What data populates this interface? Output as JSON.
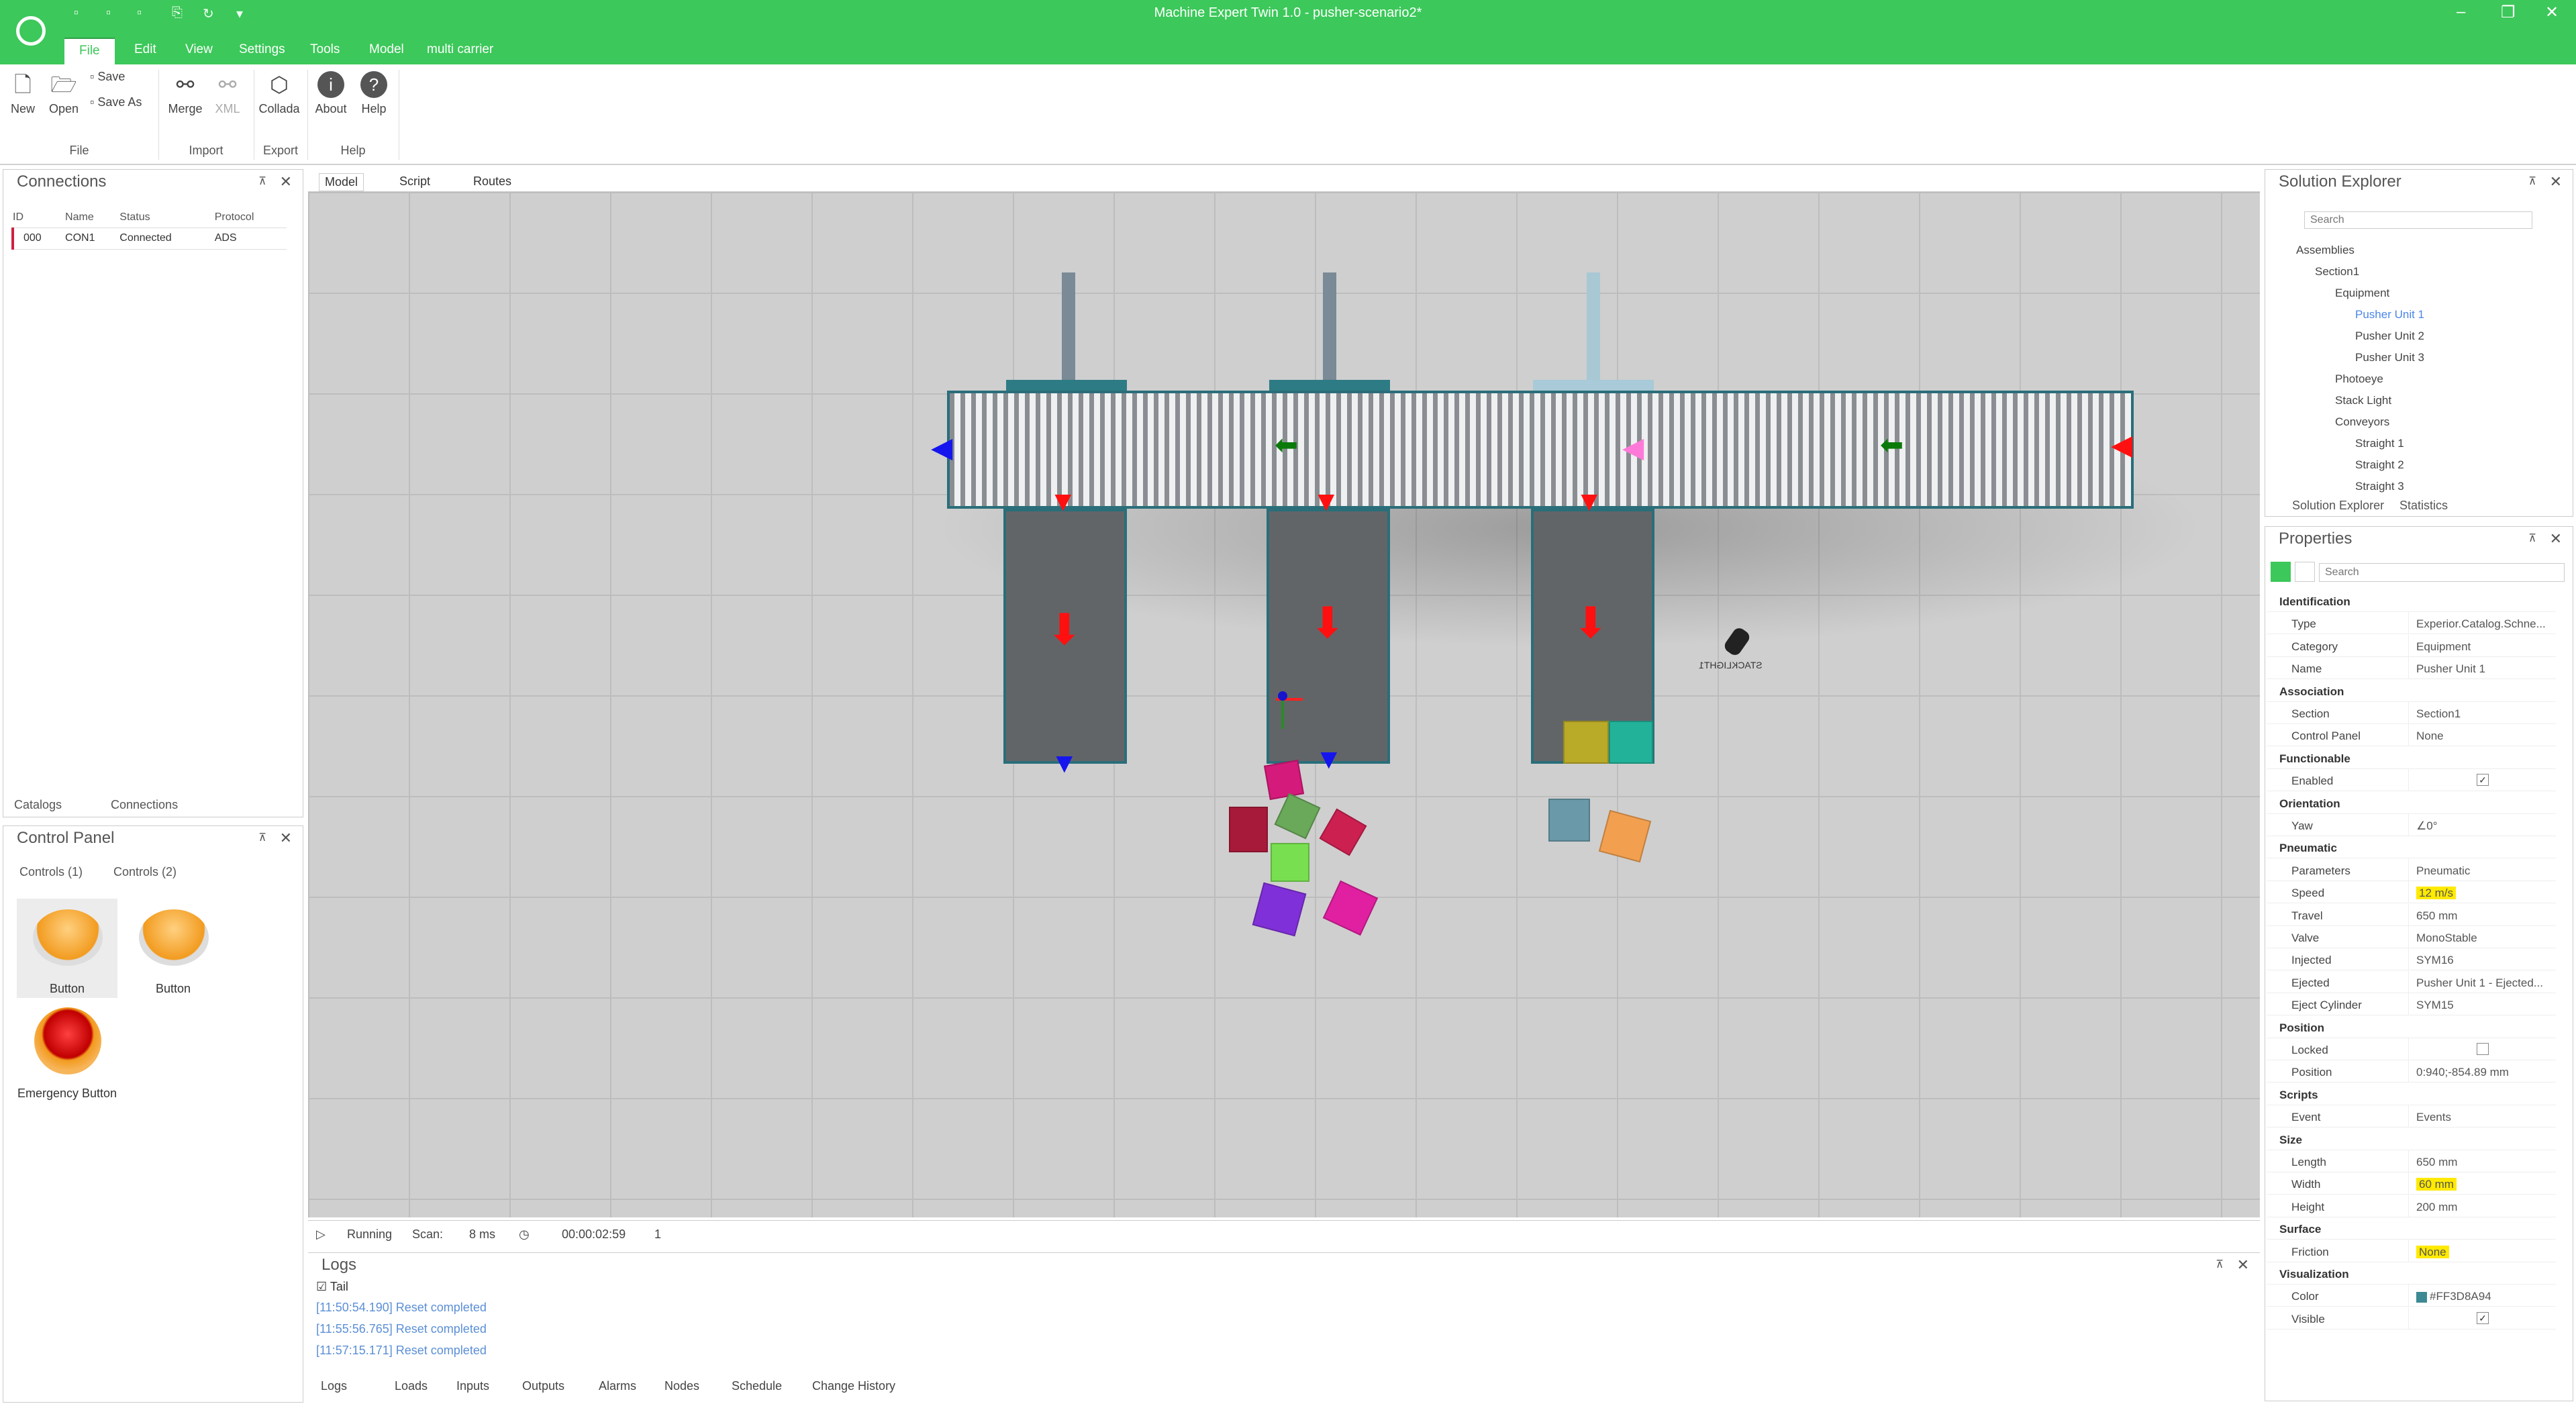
{
  "window": {
    "title": "Machine Expert Twin 1.0 - pusher-scenario2*"
  },
  "menu": [
    "File",
    "Edit",
    "View",
    "Settings",
    "Tools",
    "Model",
    "multi carrier"
  ],
  "ribbon": {
    "new": "New",
    "open": "Open",
    "save": "Save",
    "save_as": "Save As",
    "merge": "Merge",
    "xml": "XML",
    "collada": "Collada",
    "about": "About",
    "help": "Help",
    "groups": [
      "File",
      "Import",
      "Export",
      "Help"
    ]
  },
  "connections": {
    "title": "Connections",
    "headers": [
      "ID",
      "Name",
      "Status",
      "Protocol"
    ],
    "row": [
      "000",
      "CON1",
      "Connected",
      "ADS"
    ],
    "tabs": [
      "Catalogs",
      "Connections"
    ]
  },
  "control_panel": {
    "title": "Control Panel",
    "tabs": [
      "Controls (1)",
      "Controls (2)"
    ],
    "items": [
      "Button",
      "Button",
      "Emergency Button"
    ]
  },
  "doc_tabs": [
    "Model",
    "Script",
    "Routes"
  ],
  "scene": {
    "label": "STACKLIGHT1"
  },
  "status": {
    "state": "Running",
    "scan_label": "Scan:",
    "scan": "8 ms",
    "time": "00:00:02:59",
    "count": "1"
  },
  "logs": {
    "title": "Logs",
    "tail": "Tail",
    "entries": [
      "[11:50:54.190] Reset completed",
      "[11:55:56.765] Reset completed",
      "[11:57:15.171] Reset completed"
    ],
    "tabs": [
      "Logs",
      "Loads",
      "Inputs",
      "Outputs",
      "Alarms",
      "Nodes",
      "Schedule",
      "Change History"
    ]
  },
  "solution": {
    "title": "Solution Explorer",
    "search": "Search",
    "tree": [
      "Assemblies",
      "Section1",
      "Equipment",
      "Pusher Unit 1",
      "Pusher Unit 2",
      "Pusher Unit 3",
      "Photoeye",
      "Stack Light",
      "Conveyors",
      "Straight 1",
      "Straight 2",
      "Straight 3"
    ],
    "tabs": [
      "Solution Explorer",
      "Statistics"
    ]
  },
  "properties": {
    "title": "Properties",
    "search": "Search",
    "rows": [
      [
        "cat",
        "Identification",
        ""
      ],
      [
        "p",
        "Type",
        "Experior.Catalog.Schne..."
      ],
      [
        "p",
        "Category",
        "Equipment"
      ],
      [
        "p",
        "Name",
        "Pusher Unit 1"
      ],
      [
        "cat",
        "Association",
        ""
      ],
      [
        "p",
        "Section",
        "Section1"
      ],
      [
        "p",
        "Control Panel",
        "None"
      ],
      [
        "cat",
        "Functionable",
        ""
      ],
      [
        "c",
        "Enabled",
        "✓"
      ],
      [
        "cat",
        "Orientation",
        ""
      ],
      [
        "p",
        "Yaw",
        "∠0°"
      ],
      [
        "cat",
        "Pneumatic",
        ""
      ],
      [
        "p",
        "Parameters",
        "Pneumatic"
      ],
      [
        "h",
        "Speed",
        "12 m/s"
      ],
      [
        "p",
        "Travel",
        "650 mm"
      ],
      [
        "p",
        "Valve",
        "MonoStable"
      ],
      [
        "p",
        "Injected",
        "SYM16"
      ],
      [
        "p",
        "Ejected",
        "Pusher Unit 1 - Ejected..."
      ],
      [
        "p",
        "Eject Cylinder",
        "SYM15"
      ],
      [
        "cat",
        "Position",
        ""
      ],
      [
        "c",
        "Locked",
        ""
      ],
      [
        "p",
        "Position",
        "0:940;-854.89 mm"
      ],
      [
        "cat",
        "Scripts",
        ""
      ],
      [
        "p",
        "Event",
        "Events"
      ],
      [
        "cat",
        "Size",
        ""
      ],
      [
        "p",
        "Length",
        "650 mm"
      ],
      [
        "h",
        "Width",
        "60 mm"
      ],
      [
        "p",
        "Height",
        "200 mm"
      ],
      [
        "cat",
        "Surface",
        ""
      ],
      [
        "h",
        "Friction",
        "None"
      ],
      [
        "cat",
        "Visualization",
        ""
      ],
      [
        "p",
        "Color",
        "#FF3D8A94"
      ],
      [
        "c",
        "Visible",
        "✓"
      ]
    ]
  },
  "colors": {
    "accent": "#3cc85a",
    "swatch": "#3D8A94"
  }
}
